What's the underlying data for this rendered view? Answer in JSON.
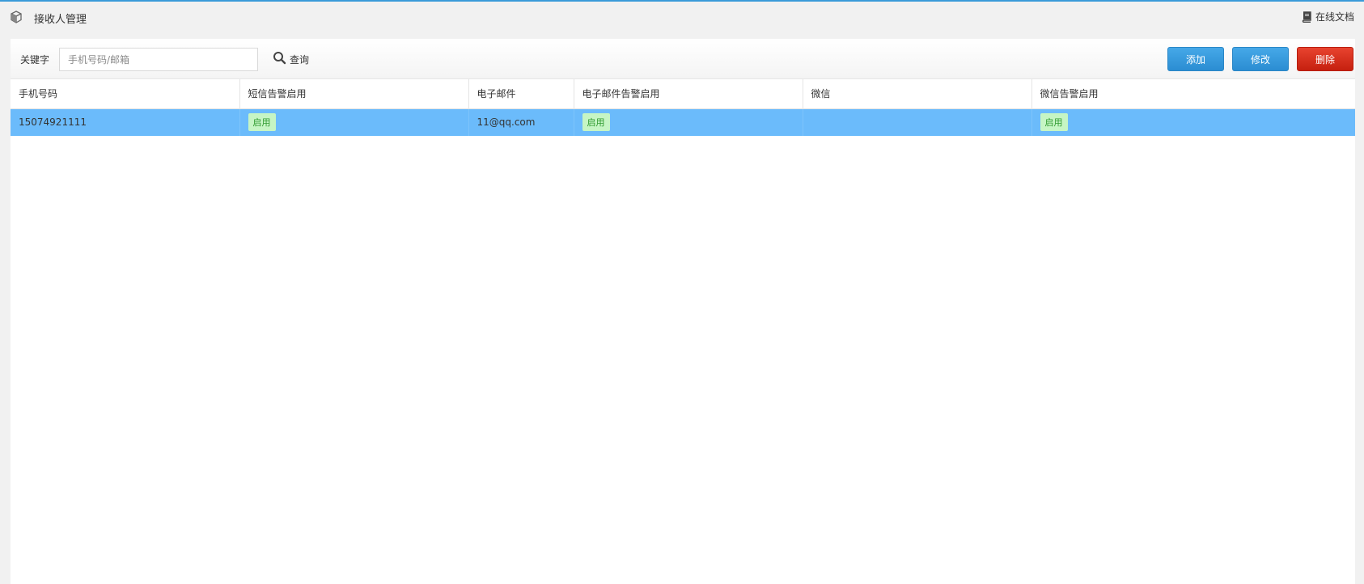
{
  "header": {
    "title": "接收人管理",
    "doc_link": "在线文档",
    "module_icon": "cube-icon",
    "doc_icon": "book-icon"
  },
  "toolbar": {
    "keyword_label": "关键字",
    "keyword_placeholder": "手机号码/邮箱",
    "keyword_value": "",
    "search_label": "查询",
    "add_label": "添加",
    "edit_label": "修改",
    "delete_label": "删除"
  },
  "table": {
    "columns": [
      "手机号码",
      "短信告警启用",
      "电子邮件",
      "电子邮件告警启用",
      "微信",
      "微信告警启用"
    ],
    "rows": [
      {
        "phone": "15074921111",
        "sms_alert": "启用",
        "email": "11@qq.com",
        "email_alert": "启用",
        "wechat": "",
        "wechat_alert": "启用",
        "selected": true
      }
    ]
  },
  "colors": {
    "accent": "#3a9bd9",
    "selected_row": "#6bbbfb",
    "enabled_badge_bg": "#c6f5c4",
    "enabled_badge_text": "#2f9a2f",
    "delete_button": "#d62a17"
  }
}
